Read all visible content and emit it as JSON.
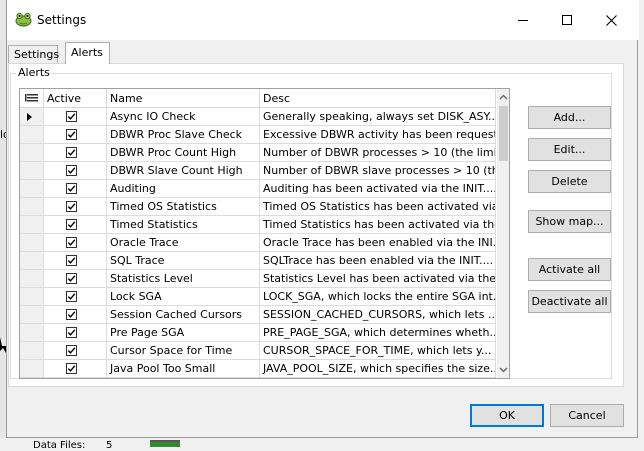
{
  "window": {
    "title": "Settings",
    "icon": "frog-app-icon",
    "minimize_icon": "minimize-icon",
    "maximize_icon": "maximize-icon",
    "close_icon": "close-icon"
  },
  "tabs": [
    {
      "label": "Settings",
      "active": false
    },
    {
      "label": "Alerts",
      "active": true
    }
  ],
  "group": {
    "label": "Alerts"
  },
  "grid": {
    "columns": [
      {
        "label": ""
      },
      {
        "label": "Active"
      },
      {
        "label": "Name"
      },
      {
        "label": "Desc"
      }
    ],
    "rows": [
      {
        "active": true,
        "name": "Async IO Check",
        "desc": "Generally speaking, always set DISK_ASY...",
        "current": true
      },
      {
        "active": true,
        "name": "DBWR Proc Slave Check",
        "desc": "Excessive DBWR activity has been request..."
      },
      {
        "active": true,
        "name": "DBWR Proc Count High",
        "desc": "Number of DBWR processes > 10 (the limit..."
      },
      {
        "active": true,
        "name": "DBWR Slave Count High",
        "desc": "Number of DBWR slave processes > 10 (th..."
      },
      {
        "active": true,
        "name": "Auditing",
        "desc": "Auditing has been activated via the INIT...."
      },
      {
        "active": true,
        "name": "Timed OS Statistics",
        "desc": "Timed OS Statistics has been activated via..."
      },
      {
        "active": true,
        "name": "Timed Statistics",
        "desc": "Timed Statistics has been activated via the..."
      },
      {
        "active": true,
        "name": "Oracle Trace",
        "desc": "Oracle Trace has been enabled via the INI..."
      },
      {
        "active": true,
        "name": "SQL Trace",
        "desc": "SQLTrace has been enabled via the INIT...."
      },
      {
        "active": true,
        "name": "Statistics Level",
        "desc": "Statistics Level has been activated via the ..."
      },
      {
        "active": true,
        "name": "Lock SGA",
        "desc": "LOCK_SGA, which locks the entire SGA int..."
      },
      {
        "active": true,
        "name": "Session Cached Cursors",
        "desc": "SESSION_CACHED_CURSORS, which lets ..."
      },
      {
        "active": true,
        "name": "Pre Page SGA",
        "desc": "PRE_PAGE_SGA, which determines wheth..."
      },
      {
        "active": true,
        "name": "Cursor Space for Time",
        "desc": "CURSOR_SPACE_FOR_TIME, which lets y..."
      },
      {
        "active": true,
        "name": "Java Pool Too Small",
        "desc": "JAVA_POOL_SIZE, which specifies the size..."
      }
    ]
  },
  "side_buttons": {
    "add": "Add...",
    "edit": "Edit...",
    "delete": "Delete",
    "show_map": "Show map...",
    "activate_all": "Activate all",
    "deactivate_all": "Deactivate all"
  },
  "footer": {
    "ok": "OK",
    "cancel": "Cancel"
  },
  "background": {
    "left_fragment": "lo",
    "bottom_text": "Data Files:",
    "bottom_value": "5"
  },
  "colors": {
    "accent": "#0078d7",
    "button_face": "#e1e1e1",
    "dialog_bg": "#f0f0f0"
  }
}
